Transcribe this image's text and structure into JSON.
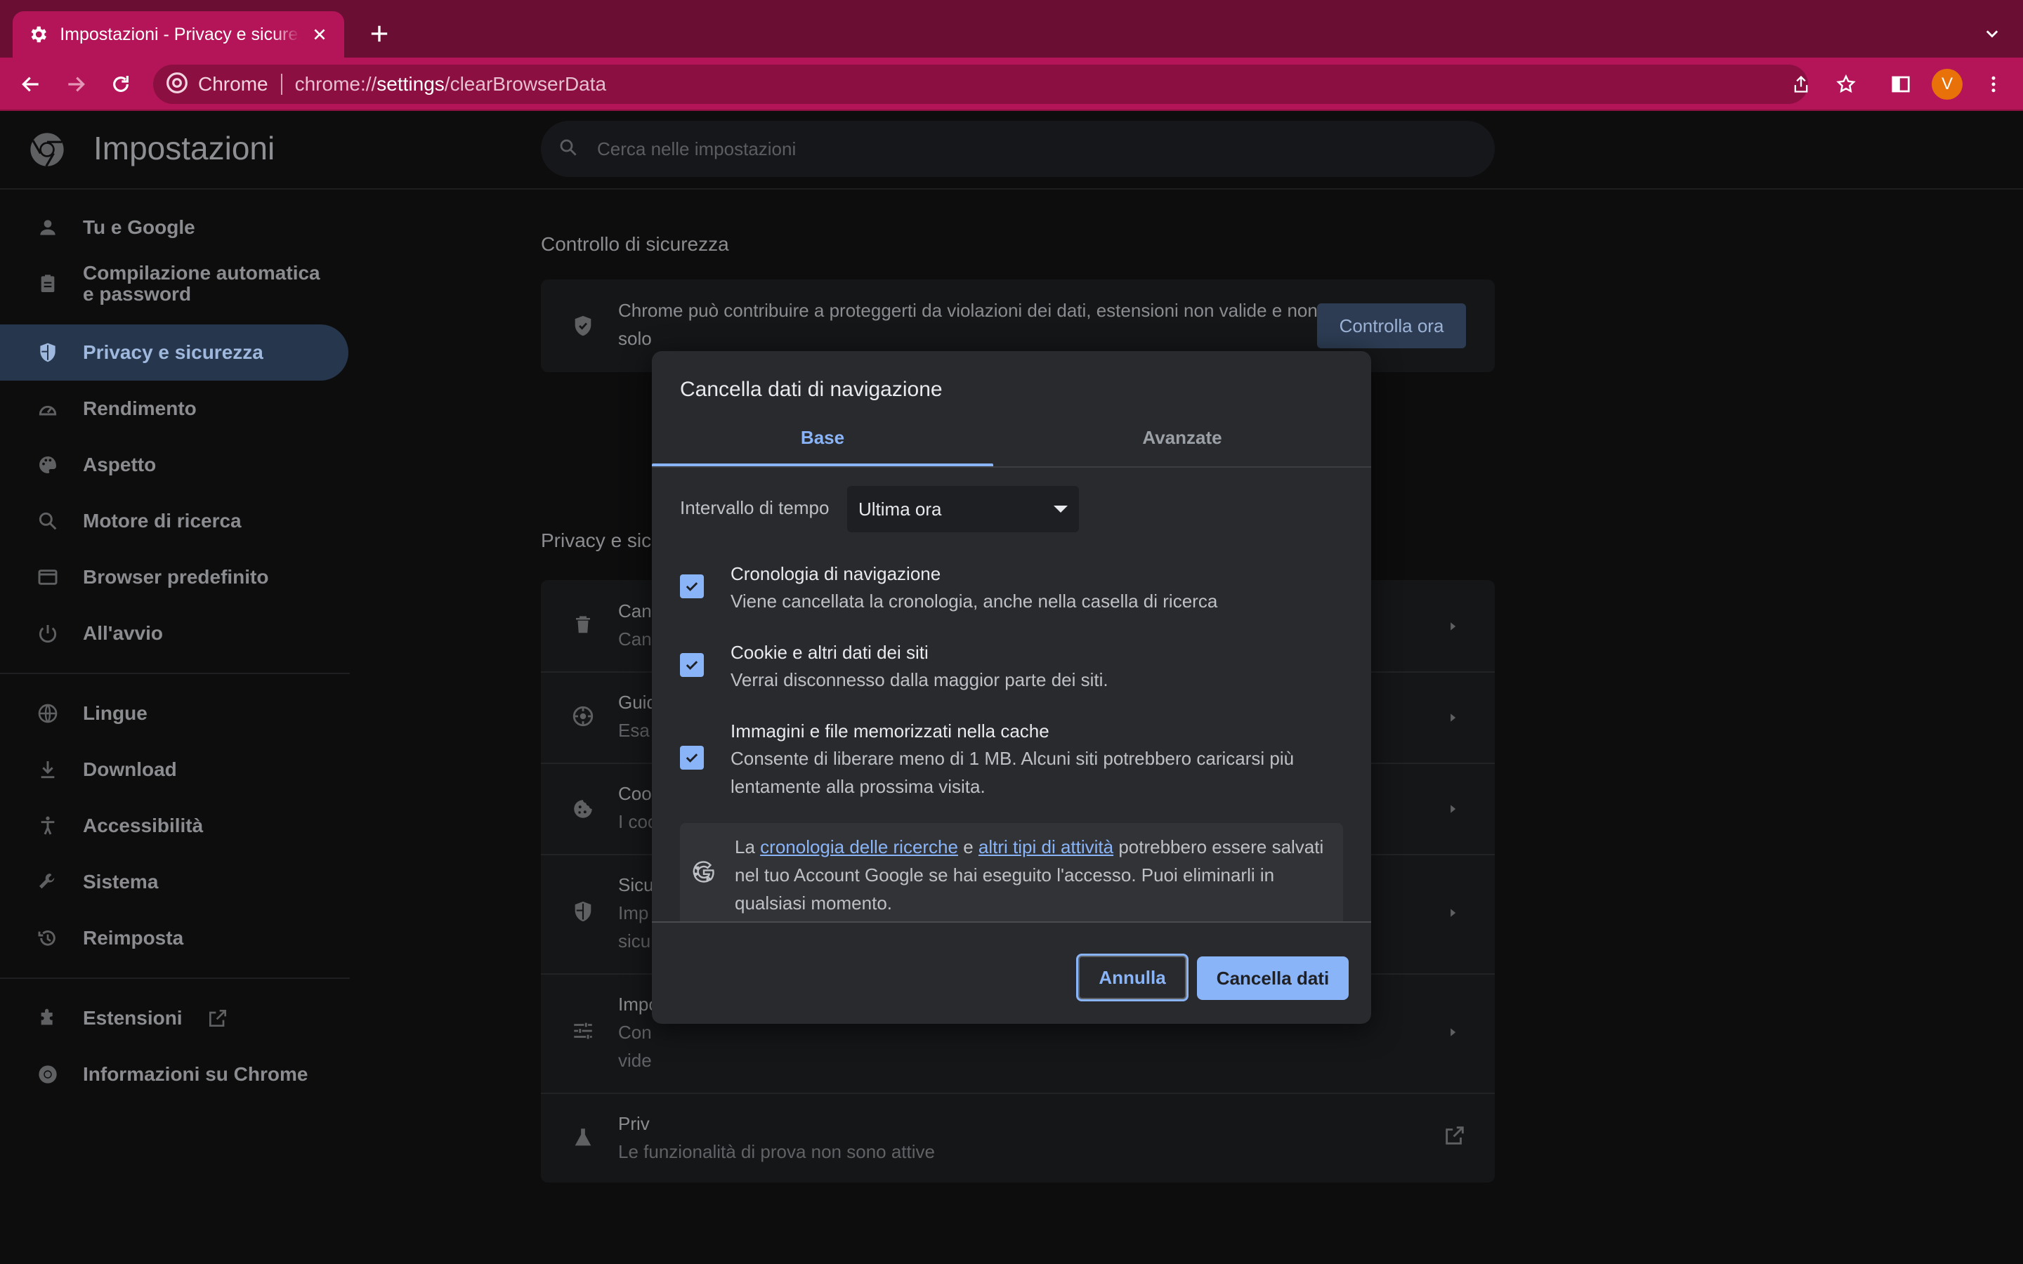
{
  "browser": {
    "tab_title": "Impostazioni - Privacy e sicurezza",
    "omnibox_site": "Chrome",
    "url_prefix": "chrome://",
    "url_host": "settings",
    "url_path": "/clearBrowserData",
    "avatar_letter": "V",
    "accent_color": "#b31558"
  },
  "header": {
    "title": "Impostazioni",
    "search_placeholder": "Cerca nelle impostazioni"
  },
  "sidebar": {
    "items": [
      {
        "label": "Tu e Google",
        "icon": "person-icon"
      },
      {
        "label": "Compilazione automatica e password",
        "icon": "clipboard-icon"
      },
      {
        "label": "Privacy e sicurezza",
        "icon": "shield-icon",
        "active": true
      },
      {
        "label": "Rendimento",
        "icon": "speedometer-icon"
      },
      {
        "label": "Aspetto",
        "icon": "palette-icon"
      },
      {
        "label": "Motore di ricerca",
        "icon": "search-icon"
      },
      {
        "label": "Browser predefinito",
        "icon": "browser-icon"
      },
      {
        "label": "All'avvio",
        "icon": "power-icon"
      },
      {
        "label": "Lingue",
        "icon": "globe-icon"
      },
      {
        "label": "Download",
        "icon": "download-icon"
      },
      {
        "label": "Accessibilità",
        "icon": "accessibility-icon"
      },
      {
        "label": "Sistema",
        "icon": "wrench-icon"
      },
      {
        "label": "Reimposta",
        "icon": "history-icon"
      },
      {
        "label": "Estensioni",
        "icon": "puzzle-icon"
      },
      {
        "label": "Informazioni su Chrome",
        "icon": "chrome-icon"
      }
    ]
  },
  "content": {
    "safety_title": "Controllo di sicurezza",
    "safety_text_1": "Chrome può contribuire a proteggerti da violazioni dei dati, estensioni non valide e non",
    "safety_text_2": "solo",
    "safety_button": "Controlla ora",
    "privacy_title": "Privacy e sic",
    "rows": [
      {
        "title": "Can",
        "sub": "Can"
      },
      {
        "title": "Guid",
        "sub": "Esa"
      },
      {
        "title": "Coo",
        "sub": "I coo"
      },
      {
        "title": "Sicu",
        "sub": "Imp",
        "sub2": "sicu"
      },
      {
        "title": "Impo",
        "sub": "Con",
        "sub2": "vide"
      },
      {
        "title": "Priv",
        "sub": "Le funzionalità di prova non sono attive"
      }
    ]
  },
  "dialog": {
    "title": "Cancella dati di navigazione",
    "tab_basic": "Base",
    "tab_advanced": "Avanzate",
    "time_range_label": "Intervallo di tempo",
    "time_range_value": "Ultima ora",
    "options": [
      {
        "title": "Cronologia di navigazione",
        "desc": "Viene cancellata la cronologia, anche nella casella di ricerca",
        "checked": true
      },
      {
        "title": "Cookie e altri dati dei siti",
        "desc": "Verrai disconnesso dalla maggior parte dei siti.",
        "checked": true
      },
      {
        "title": "Immagini e file memorizzati nella cache",
        "desc": "Consente di liberare meno di 1 MB. Alcuni siti potrebbero caricarsi più lentamente alla prossima visita.",
        "checked": true
      }
    ],
    "google_note": {
      "pre": "La ",
      "link1": "cronologia delle ricerche",
      "mid": " e ",
      "link2": "altri tipi di attività",
      "post": " potrebbero essere salvati nel tuo Account Google se hai eseguito l'accesso. Puoi eliminarli in qualsiasi momento."
    },
    "cancel_label": "Annulla",
    "clear_label": "Cancella dati"
  }
}
